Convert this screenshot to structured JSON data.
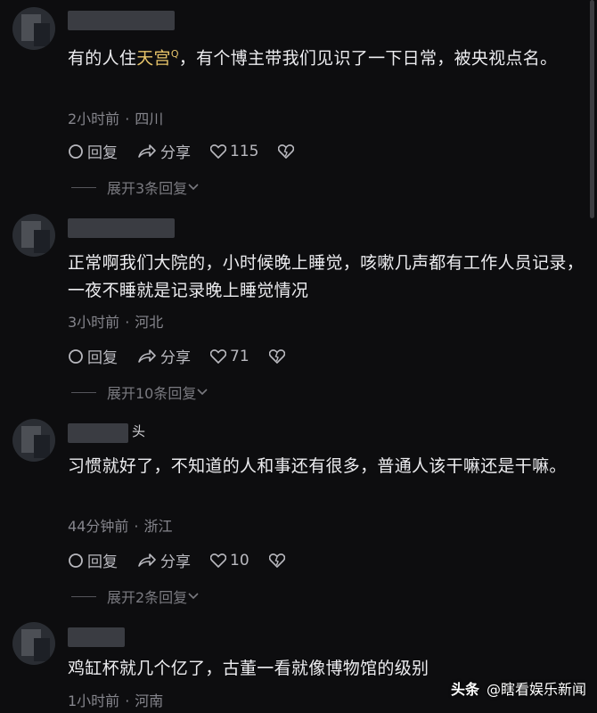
{
  "comments": [
    {
      "username_tail": "",
      "text_before": "有的人住",
      "highlight": "天宫",
      "search_glyph": "Q",
      "text_after": "，有个博主带我们见识了一下日常，被央视点名。",
      "meta_time": "2小时前",
      "meta_sep": "·",
      "meta_location": "四川",
      "reply_label": "回复",
      "share_label": "分享",
      "like_count": "115",
      "expand_label": "展开3条回复"
    },
    {
      "username_tail": "",
      "text_before": "正常啊我们大院的，小时候晚上睡觉，咳嗽几声都有工作人员记录，一夜不睡就是记录晚上睡觉情况",
      "highlight": "",
      "search_glyph": "",
      "text_after": "",
      "meta_time": "3小时前",
      "meta_sep": "·",
      "meta_location": "河北",
      "reply_label": "回复",
      "share_label": "分享",
      "like_count": "71",
      "expand_label": "展开10条回复"
    },
    {
      "username_tail": "头",
      "text_before": "习惯就好了，不知道的人和事还有很多，普通人该干嘛还是干嘛。",
      "highlight": "",
      "search_glyph": "",
      "text_after": "",
      "meta_time": "44分钟前",
      "meta_sep": "·",
      "meta_location": "浙江",
      "reply_label": "回复",
      "share_label": "分享",
      "like_count": "10",
      "expand_label": "展开2条回复"
    },
    {
      "username_tail": "",
      "text_before": "鸡缸杯就几个亿了，古董一看就像博物馆的级别",
      "highlight": "",
      "search_glyph": "",
      "text_after": "",
      "meta_time": "1小时前",
      "meta_sep": "·",
      "meta_location": "河南"
    }
  ],
  "watermark": {
    "brand": "头条",
    "handle": "@瞎看娱乐新闻"
  },
  "colors": {
    "background": "#0d0d0f",
    "highlight": "#e7c46a",
    "meta": "#85858c"
  }
}
